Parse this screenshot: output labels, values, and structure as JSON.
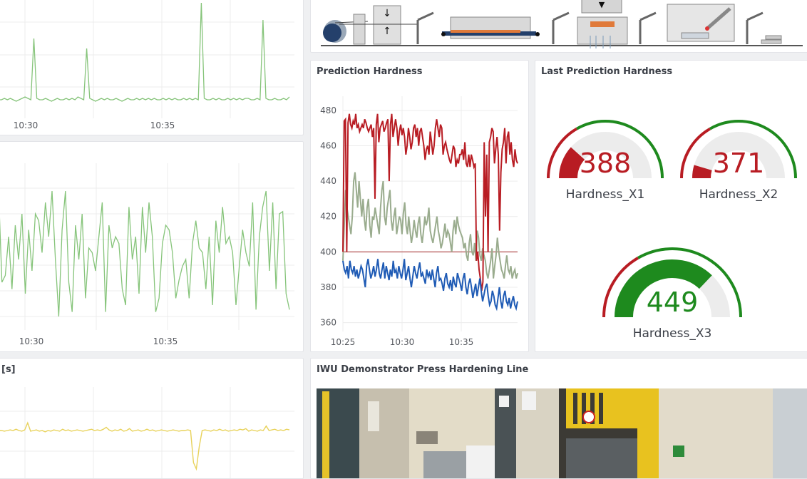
{
  "colors": {
    "green_series": "#86c47a",
    "yellow_series": "#e8d25a",
    "red_series": "#b81c23",
    "olive_series": "#9aac8e",
    "blue_series": "#1f5bb5",
    "threshold": "#c07070",
    "gauge_red": "#b81c23",
    "gauge_green": "#1e8a1e",
    "gauge_track": "#ececec"
  },
  "top_left_chart": {
    "x_ticks": [
      "10:30",
      "10:35"
    ]
  },
  "mid_left_chart": {
    "x_ticks": [
      "10:30",
      "10:35"
    ]
  },
  "bottom_left_panel": {
    "title_fragment": "[s]"
  },
  "diagram": {
    "icons": [
      "coil-icon",
      "press-arrows-icon",
      "robot-arm-icon",
      "furnace-icon",
      "robot-arm-icon",
      "press-icon",
      "robot-arm-icon",
      "inspection-icon",
      "robot-arm-icon",
      "stack-icon"
    ]
  },
  "prediction_hardness": {
    "title": "Prediction Hardness"
  },
  "last_prediction": {
    "title": "Last Prediction Hardness",
    "gauges": [
      {
        "label": "Hardness_X1",
        "value": 388,
        "min": 360,
        "max": 480,
        "green_from": 400
      },
      {
        "label": "Hardness_X2",
        "value": 371,
        "min": 360,
        "max": 480,
        "green_from": 400
      },
      {
        "label": "Hardness_X3",
        "value": 449,
        "min": 360,
        "max": 480,
        "green_from": 400
      }
    ]
  },
  "photo_panel": {
    "title": "IWU Demonstrator Press Hardening Line"
  },
  "chart_data": [
    {
      "type": "line",
      "title": "",
      "x_ticks": [
        "10:30",
        "10:35"
      ],
      "series": [
        {
          "values": [
            2,
            2,
            3,
            2,
            3,
            2,
            1,
            2,
            3,
            4,
            3,
            2,
            45,
            3,
            2,
            2,
            3,
            2,
            1,
            2,
            3,
            2,
            2,
            3,
            2,
            3,
            2,
            4,
            3,
            2,
            38,
            3,
            2,
            1,
            2,
            3,
            2,
            3,
            2,
            2,
            3,
            2,
            1,
            2,
            3,
            2,
            2,
            3,
            2,
            3,
            2,
            3,
            2,
            3,
            2,
            2,
            3,
            2,
            3,
            2,
            3,
            2,
            2,
            3,
            2,
            3,
            2,
            3,
            2,
            70,
            3,
            2,
            2,
            3,
            2,
            3,
            2,
            2,
            3,
            2,
            3,
            2,
            3,
            2,
            3,
            3,
            2,
            2,
            3,
            2,
            58,
            3,
            2,
            2,
            3,
            2,
            2,
            3,
            2,
            4
          ]
        }
      ]
    },
    {
      "type": "line",
      "title": "",
      "x_ticks": [
        "10:30",
        "10:35"
      ],
      "series": [
        {
          "values": [
            55,
            15,
            18,
            35,
            12,
            40,
            25,
            45,
            10,
            38,
            20,
            45,
            42,
            28,
            50,
            35,
            55,
            25,
            0,
            38,
            55,
            15,
            2,
            40,
            25,
            45,
            8,
            30,
            28,
            20,
            35,
            50,
            2,
            40,
            30,
            35,
            32,
            12,
            5,
            48,
            25,
            35,
            10,
            48,
            28,
            50,
            35,
            2,
            8,
            32,
            40,
            38,
            28,
            8,
            16,
            22,
            25,
            8,
            32,
            42,
            30,
            28,
            12,
            35,
            5,
            42,
            28,
            48,
            32,
            35,
            28,
            5,
            22,
            38,
            28,
            22,
            50,
            3,
            35,
            48,
            55,
            20,
            50,
            12,
            45,
            46,
            10,
            3
          ]
        }
      ]
    },
    {
      "type": "line",
      "title": "[s]",
      "x_ticks": [],
      "series": [
        {
          "values": [
            10,
            10,
            9,
            10,
            11,
            10,
            12,
            10,
            9,
            11,
            22,
            9,
            10,
            11,
            9,
            10,
            8,
            10,
            9,
            11,
            10,
            9,
            12,
            10,
            11,
            9,
            10,
            11,
            10,
            9,
            10,
            11,
            12,
            10,
            11,
            10,
            12,
            15,
            11,
            9,
            11,
            10,
            12,
            9,
            10,
            13,
            9,
            10,
            11,
            9,
            10,
            12,
            10,
            11,
            9,
            10,
            11,
            10,
            9,
            10,
            11,
            10,
            9,
            10,
            10,
            11,
            10,
            -40,
            -50,
            -15,
            10,
            11,
            10,
            9,
            11,
            10,
            12,
            10,
            11,
            9,
            10,
            11,
            10,
            12,
            11,
            13,
            9,
            11,
            10,
            9,
            11,
            10,
            17,
            10,
            11,
            12,
            10,
            11,
            10,
            12,
            11
          ]
        }
      ]
    },
    {
      "type": "line",
      "title": "Prediction Hardness",
      "x_ticks": [
        "10:25",
        "10:30",
        "10:35"
      ],
      "y_ticks": [
        360,
        380,
        400,
        420,
        440,
        460,
        480
      ],
      "ylim": [
        355,
        488
      ],
      "threshold": 400,
      "series": [
        {
          "values": [
            400,
            474,
            475,
            400,
            473,
            478,
            472,
            470,
            474,
            472,
            478,
            470,
            472,
            468,
            470,
            472,
            470,
            475,
            473,
            470,
            468,
            470,
            472,
            465,
            470,
            430,
            472,
            478,
            462,
            470,
            472,
            474,
            468,
            470,
            473,
            475,
            440,
            472,
            478,
            465,
            470,
            475,
            470,
            460,
            468,
            472,
            466,
            470,
            465,
            455,
            460,
            470,
            465,
            458,
            462,
            470,
            472,
            465,
            470,
            460,
            468,
            470,
            465,
            460,
            452,
            458,
            460,
            455,
            468,
            462,
            455,
            460,
            470,
            475,
            470,
            465,
            472,
            470,
            455,
            460,
            462,
            458,
            455,
            452,
            450,
            455,
            460,
            458,
            448,
            452,
            450,
            455,
            455,
            458,
            452,
            462,
            450,
            448,
            455,
            448,
            455,
            452,
            448,
            450,
            395,
            400,
            390,
            385,
            378,
            383,
            462,
            420,
            455,
            400,
            462,
            465,
            470,
            468,
            450,
            458,
            465,
            455,
            412,
            445,
            458,
            462,
            470,
            450,
            465,
            468,
            455,
            462,
            452,
            448,
            458,
            452,
            450
          ]
        },
        {
          "values": [
            395,
            415,
            435,
            425,
            420,
            415,
            410,
            420,
            440,
            445,
            435,
            425,
            440,
            430,
            420,
            430,
            418,
            412,
            425,
            430,
            415,
            408,
            420,
            418,
            425,
            420,
            415,
            410,
            425,
            435,
            440,
            420,
            415,
            425,
            430,
            435,
            418,
            412,
            420,
            425,
            410,
            415,
            420,
            418,
            410,
            422,
            428,
            415,
            410,
            420,
            412,
            405,
            410,
            418,
            412,
            408,
            416,
            420,
            410,
            405,
            412,
            420,
            415,
            418,
            425,
            412,
            408,
            405,
            410,
            415,
            420,
            412,
            408,
            402,
            405,
            410,
            416,
            408,
            412,
            410,
            405,
            400,
            412,
            418,
            410,
            420,
            415,
            412,
            410,
            408,
            402,
            405,
            398,
            395,
            405,
            410,
            400,
            398,
            405,
            395,
            412,
            408,
            398,
            395,
            402,
            398,
            395,
            388,
            385,
            390,
            395,
            402,
            385,
            392,
            398,
            408,
            400,
            395,
            390,
            388,
            385,
            392,
            398,
            390,
            388,
            392,
            385,
            388,
            390,
            385,
            388
          ]
        },
        {
          "values": [
            395,
            390,
            388,
            392,
            385,
            395,
            390,
            388,
            392,
            386,
            390,
            385,
            388,
            392,
            390,
            385,
            380,
            392,
            396,
            390,
            385,
            388,
            392,
            386,
            390,
            396,
            388,
            385,
            390,
            394,
            385,
            392,
            388,
            384,
            390,
            386,
            395,
            388,
            390,
            385,
            392,
            388,
            385,
            390,
            396,
            384,
            388,
            392,
            385,
            380,
            386,
            392,
            388,
            385,
            390,
            394,
            386,
            388,
            385,
            382,
            390,
            386,
            388,
            384,
            390,
            385,
            380,
            388,
            392,
            384,
            385,
            382,
            378,
            385,
            388,
            382,
            380,
            384,
            378,
            386,
            382,
            380,
            388,
            385,
            382,
            378,
            385,
            388,
            380,
            376,
            382,
            385,
            380,
            374,
            378,
            382,
            375,
            380,
            385,
            378,
            372,
            376,
            380,
            382,
            375,
            370,
            372,
            378,
            375,
            370,
            368,
            374,
            380,
            372,
            368,
            375,
            378,
            372,
            370,
            374,
            368,
            372,
            375,
            370,
            368,
            372
          ]
        }
      ]
    },
    {
      "type": "gauge",
      "title": "Last Prediction Hardness",
      "series": [
        {
          "name": "Hardness_X1",
          "values": [
            388
          ]
        },
        {
          "name": "Hardness_X2",
          "values": [
            371
          ]
        },
        {
          "name": "Hardness_X3",
          "values": [
            449
          ]
        }
      ]
    }
  ]
}
